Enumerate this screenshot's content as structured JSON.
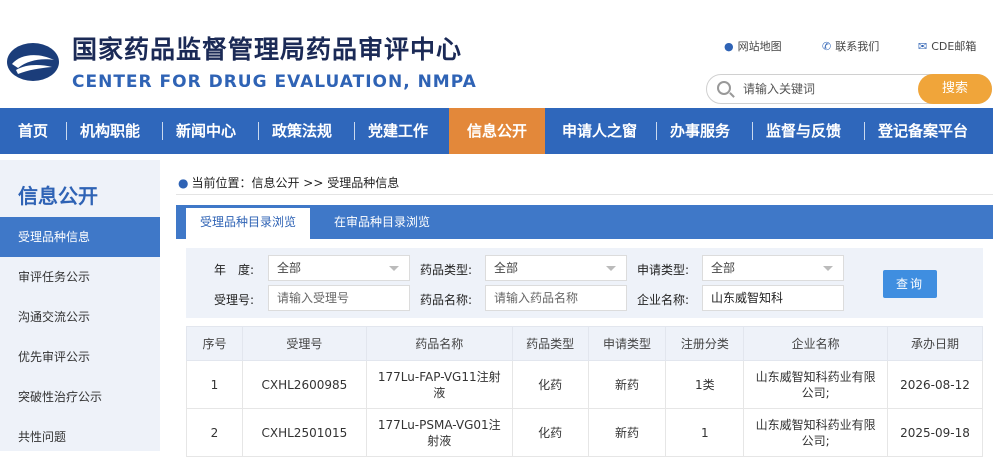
{
  "header": {
    "title_cn": "国家药品监督管理局药品审评中心",
    "title_en": "CENTER FOR DRUG EVALUATION, NMPA",
    "links": [
      {
        "icon": "map-pin-icon",
        "label": "网站地图"
      },
      {
        "icon": "phone-icon",
        "label": "联系我们"
      },
      {
        "icon": "mail-icon",
        "label": "CDE邮箱"
      }
    ],
    "search_placeholder": "请输入关键词",
    "search_button": "搜索"
  },
  "nav": {
    "items": [
      "首页",
      "机构职能",
      "新闻中心",
      "政策法规",
      "党建工作",
      "信息公开",
      "申请人之窗",
      "办事服务",
      "监督与反馈",
      "登记备案平台"
    ],
    "active": "信息公开"
  },
  "sidebar": {
    "title": "信息公开",
    "items": [
      "受理品种信息",
      "审评任务公示",
      "沟通交流公示",
      "优先审评公示",
      "突破性治疗公示",
      "共性问题"
    ],
    "active": "受理品种信息"
  },
  "breadcrumb": {
    "text": "当前位置：信息公开 >> 受理品种信息"
  },
  "tabs": [
    "受理品种目录浏览",
    "在审品种目录浏览"
  ],
  "filters": {
    "year_label": "年　度:",
    "year_value": "全部",
    "drug_type_label": "药品类型:",
    "drug_type_value": "全部",
    "apply_type_label": "申请类型:",
    "apply_type_value": "全部",
    "accept_no_label": "受理号:",
    "accept_no_placeholder": "请输入受理号",
    "drug_name_label": "药品名称:",
    "drug_name_placeholder": "请输入药品名称",
    "company_label": "企业名称:",
    "company_value": "山东威智知科",
    "query_button": "查询"
  },
  "table": {
    "headers": [
      "序号",
      "受理号",
      "药品名称",
      "药品类型",
      "申请类型",
      "注册分类",
      "企业名称",
      "承办日期"
    ],
    "rows": [
      [
        "1",
        "CXHL2600985",
        "177Lu-FAP-VG11注射液",
        "化药",
        "新药",
        "1类",
        "山东威智知科药业有限公司;",
        "2026-08-12"
      ],
      [
        "2",
        "CXHL2501015",
        "177Lu-PSMA-VG01注射液",
        "化药",
        "新药",
        "1",
        "山东威智知科药业有限公司;",
        "2025-09-18"
      ]
    ]
  },
  "colors": {
    "nav_blue": "#2f67bb",
    "nav_active": "#e3883a",
    "search_button": "#f0a53a",
    "accent_blue": "#3f78c8"
  }
}
